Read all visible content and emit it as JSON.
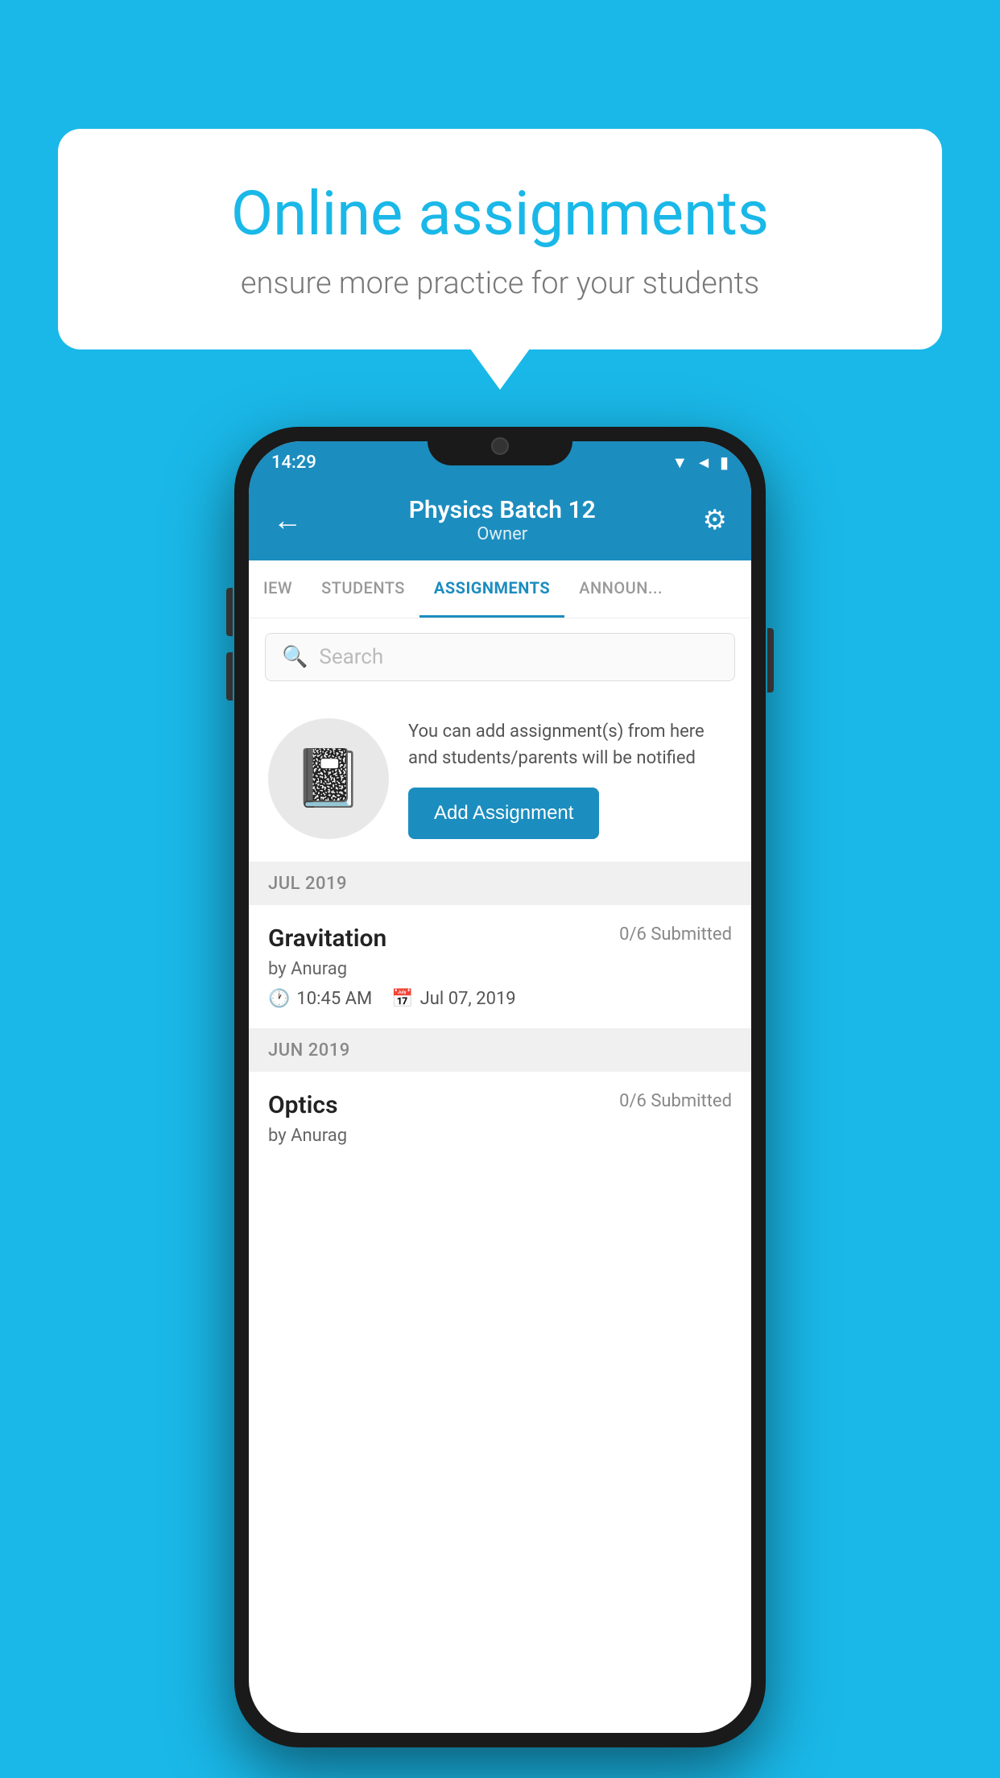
{
  "background_color": "#1ab8e8",
  "speech_bubble": {
    "title": "Online assignments",
    "subtitle": "ensure more practice for your students"
  },
  "status_bar": {
    "time": "14:29",
    "icons": [
      "wifi",
      "signal",
      "battery"
    ]
  },
  "app_header": {
    "title": "Physics Batch 12",
    "subtitle": "Owner",
    "back_label": "←",
    "settings_label": "⚙"
  },
  "tabs": [
    {
      "label": "IEW",
      "active": false
    },
    {
      "label": "STUDENTS",
      "active": false
    },
    {
      "label": "ASSIGNMENTS",
      "active": true
    },
    {
      "label": "ANNOUNCEMENTS",
      "active": false
    }
  ],
  "search": {
    "placeholder": "Search"
  },
  "promo": {
    "description": "You can add assignment(s) from here and students/parents will be notified",
    "button_label": "Add Assignment"
  },
  "month_groups": [
    {
      "month": "JUL 2019",
      "assignments": [
        {
          "title": "Gravitation",
          "submitted": "0/6 Submitted",
          "by": "by Anurag",
          "time": "10:45 AM",
          "date": "Jul 07, 2019"
        }
      ]
    },
    {
      "month": "JUN 2019",
      "assignments": [
        {
          "title": "Optics",
          "submitted": "0/6 Submitted",
          "by": "by Anurag"
        }
      ]
    }
  ]
}
